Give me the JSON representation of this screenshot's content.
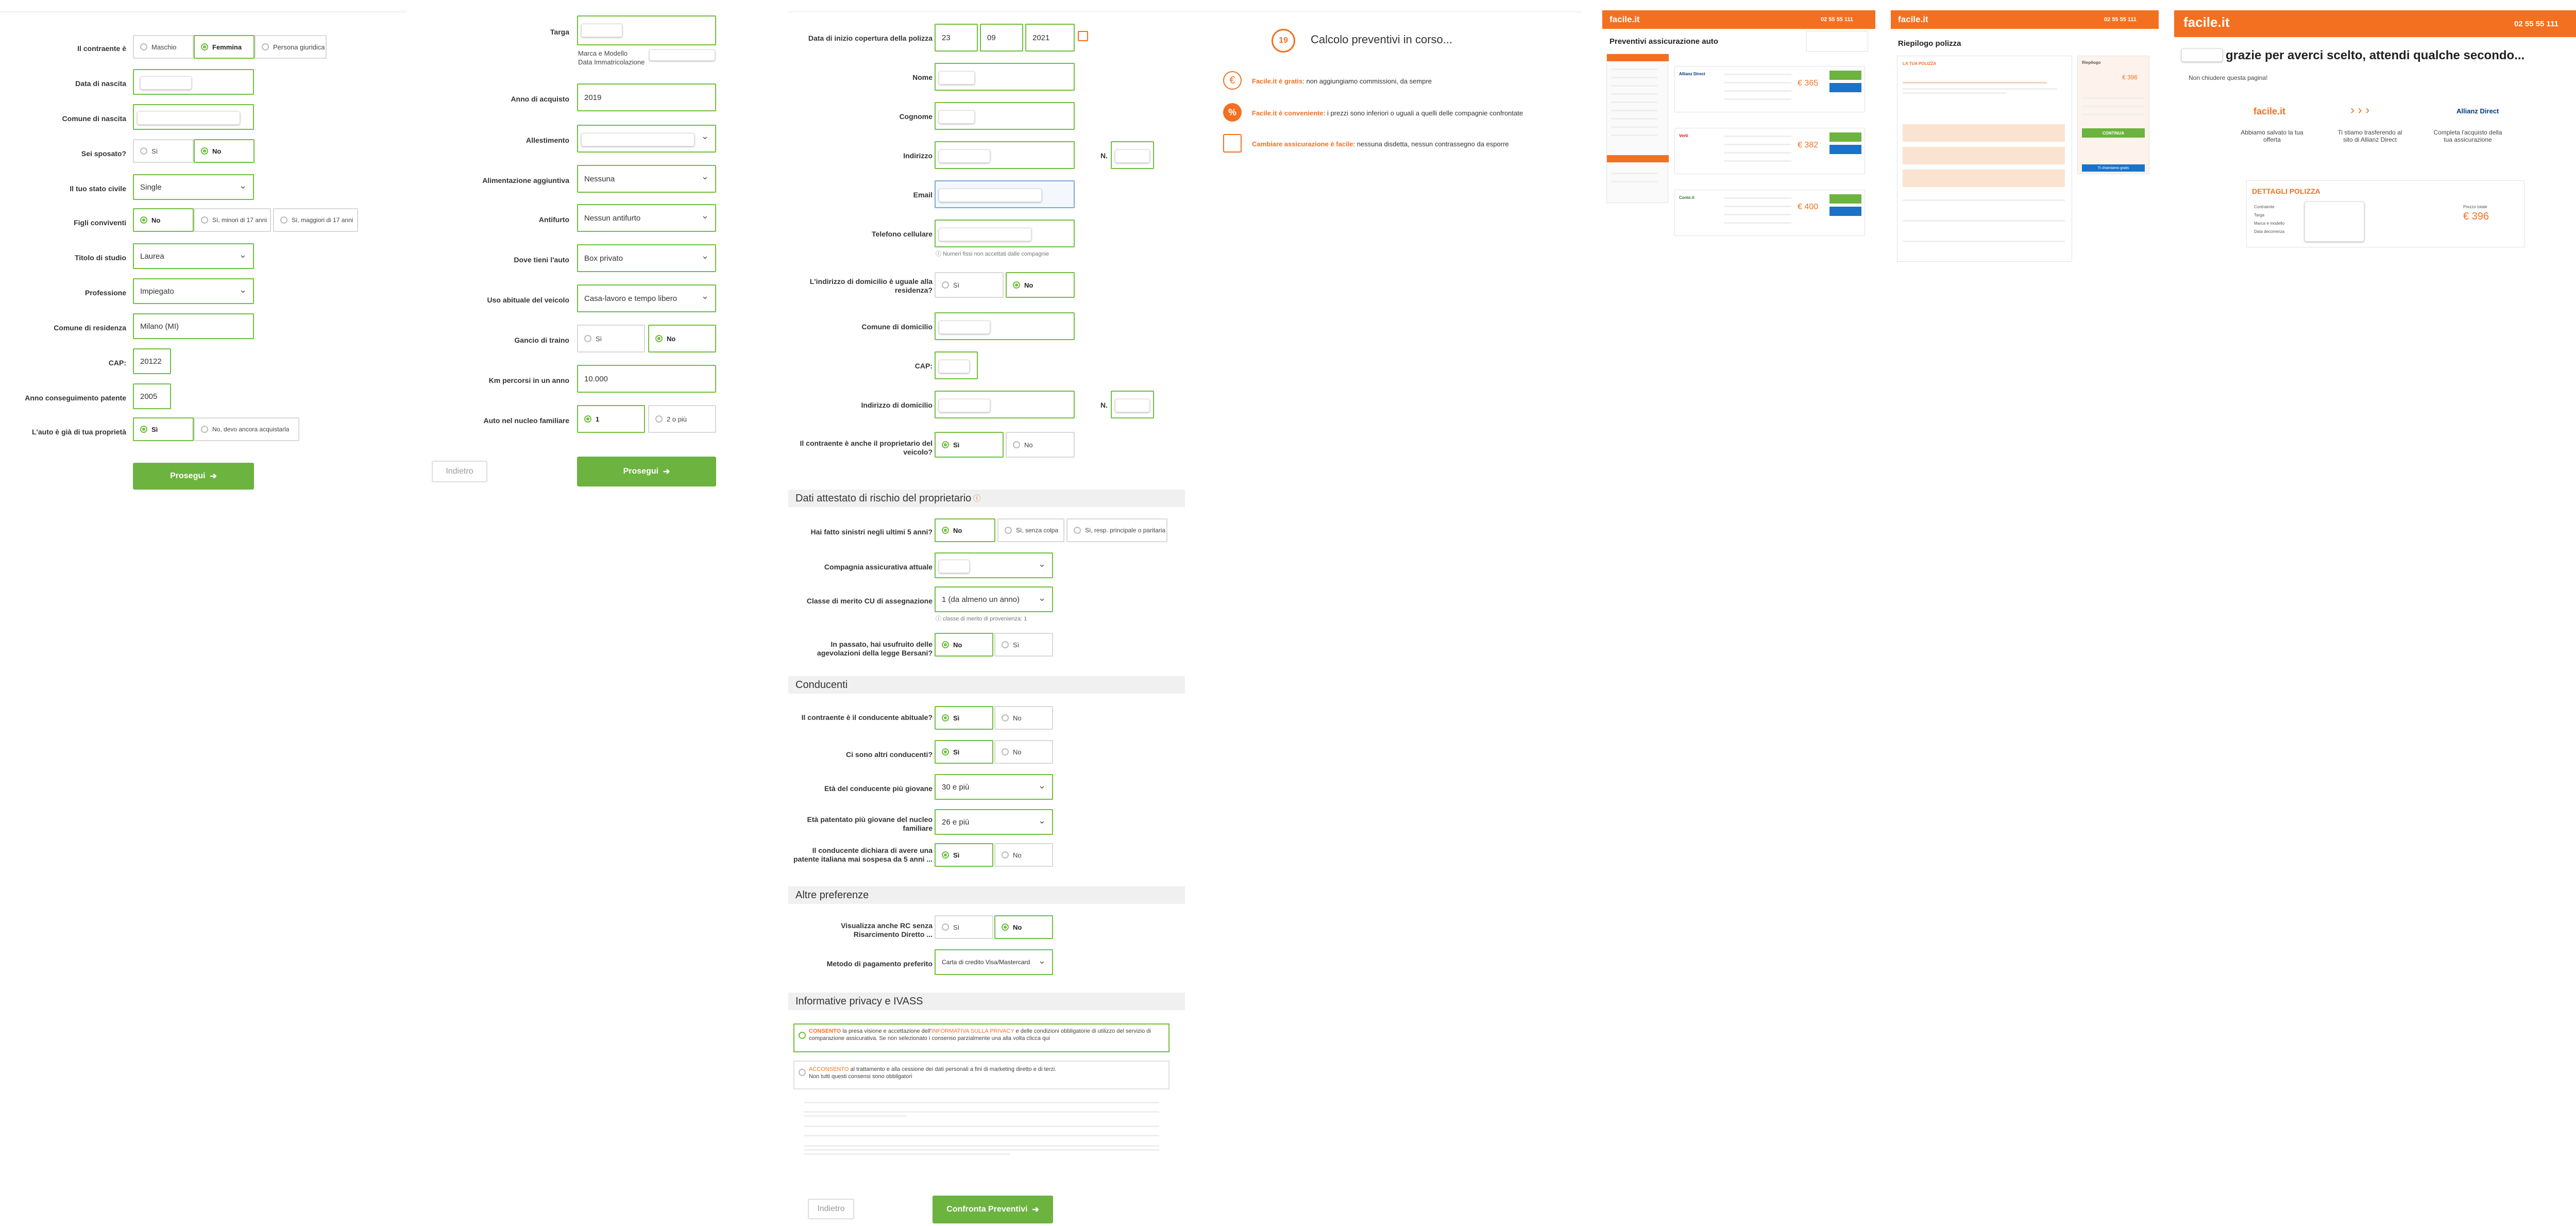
{
  "panel1": {
    "contraente_label": "Il contraente è",
    "gender_options": [
      "Maschio",
      "Femmina",
      "Persona giuridica"
    ],
    "data_nascita_label": "Data di nascita",
    "comune_nascita_label": "Comune di nascita",
    "sposato_label": "Sei sposato?",
    "yes": "Sì",
    "no": "No",
    "stato_civile_label": "Il tuo stato civile",
    "stato_civile_value": "Single",
    "figli_label": "Figli conviventi",
    "figli_options": [
      "No",
      "Sì, minori di 17 anni",
      "Sì, maggiori di 17 anni"
    ],
    "titolo_studio_label": "Titolo di studio",
    "titolo_studio_value": "Laurea",
    "professione_label": "Professione",
    "professione_value": "Impiegato",
    "comune_residenza_label": "Comune di residenza",
    "comune_residenza_value": "Milano (MI)",
    "cap_label": "CAP:",
    "cap_value": "20122",
    "anno_patente_label": "Anno conseguimento patente",
    "anno_patente_value": "2005",
    "auto_label": "L'auto è già di tua proprietà",
    "auto_options": [
      "Sì",
      "No, devo ancora acquistarla"
    ],
    "prosegui": "Prosegui"
  },
  "panel2": {
    "targa_label": "Targa",
    "targa_hint_1": "Marca e Modello",
    "targa_hint_2": "Data Immatricolazione",
    "anno_acquisto_label": "Anno di acquisto",
    "anno_acquisto_value": "2019",
    "allestimento_label": "Allestimento",
    "alimentazione_label": "Alimentazione aggiuntiva",
    "alimentazione_value": "Nessuna",
    "antifurto_label": "Antifurto",
    "antifurto_value": "Nessun antifurto",
    "dove_label": "Dove tieni l'auto",
    "dove_value": "Box privato",
    "uso_label": "Uso abituale del veicolo",
    "uso_value": "Casa-lavoro e tempo libero",
    "gancio_label": "Gancio di traino",
    "yes": "Sì",
    "no": "No",
    "km_label": "Km percorsi in un anno",
    "km_value": "10.000",
    "auto_nucleo_label": "Auto nel nucleo familiare",
    "auto_nucleo_options": [
      "1",
      "2 o più"
    ],
    "indietro": "Indietro",
    "prosegui": "Prosegui"
  },
  "panel3": {
    "data_inizio_label": "Data di inizio copertura della polizza",
    "data_inizio": [
      "23",
      "09",
      "2021"
    ],
    "nome_label": "Nome",
    "cognome_label": "Cognome",
    "indirizzo_label": "Indirizzo",
    "n_label": "N.",
    "email_label": "Email",
    "telefono_label": "Telefono cellulare",
    "telefono_hint": "Numeri fissi non accettati dalle compagnie",
    "domicilio_uguale_label": "L'indirizzo di domicilio è uguale alla residenza?",
    "yes": "Sì",
    "no": "No",
    "comune_domicilio_label": "Comune di domicilio",
    "cap_label": "CAP:",
    "indirizzo_domicilio_label": "Indirizzo di domicilio",
    "proprietario_label": "Il contraente è anche il proprietario del veicolo?",
    "sec_attestato": "Dati attestato di rischio del proprietario",
    "sinistri_label": "Hai fatto sinistri negli ultimi 5 anni?",
    "sinistri_options": [
      "No",
      "Sì, senza colpa",
      "Sì, resp. principale o paritaria"
    ],
    "compagnia_label": "Compagnia assicurativa attuale",
    "classe_label": "Classe di merito CU di assegnazione",
    "classe_value": "1 (da almeno un anno)",
    "classe_hint": "classe di merito di provenienza: 1",
    "bersani_label": "In passato, hai usufruito delle agevolazioni della legge Bersani?",
    "sec_conducenti": "Conducenti",
    "conducente_abituale_label": "Il contraente è il conducente abituale?",
    "altri_conducenti_label": "Ci sono altri conducenti?",
    "eta_giovane_label": "Età del conducente più giovane",
    "eta_giovane_value": "30 e più",
    "patentato_label": "Età patentato più giovane del nucleo familiare",
    "patentato_value": "26 e più",
    "sospesa_label": "Il conducente dichiara di avere una patente italiana mai sospesa da 5 anni ...",
    "sec_preferenze": "Altre preferenze",
    "rc_label": "Visualizza anche RC senza Risarcimento Diretto ...",
    "pagamento_label": "Metodo di pagamento preferito",
    "pagamento_value": "Carta di credito Visa/Mastercard",
    "sec_privacy": "Informative privacy e IVASS",
    "consent1_strong": "CONSENTO",
    "consent1_mid": " la presa visione e accettazione dell'",
    "consent1_link": "INFORMATIVA SULLA PRIVACY",
    "consent1_rest": " e delle condizioni obbligatorie di utilizzo del servizio di comparazione assicurativa. Se non selezionato i consenso parzialmente una alla volta clicca qui",
    "consent2_strong": "ACCONSENTO",
    "consent2_rest": " al trattamento e alla cessione dei dati personali a fini di marketing diretto e di terzi.",
    "consent2_note": "Non tutti questi consensi sono obbligatori",
    "indietro": "Indietro",
    "confronta": "Confronta Preventivi"
  },
  "panel4": {
    "step_number": "19",
    "title": "Calcolo preventivi in corso...",
    "b1_strong": "Facile.it è gratis",
    "b1_rest": ": non aggiungiamo commissioni, da sempre",
    "b2_strong": "Facile.it è conveniente",
    "b2_rest": ": i prezzi sono inferiori o uguali a quelli delle compagnie confrontate",
    "b3_strong": "Cambiare assicurazione è facile",
    "b3_rest": ": nessuna disdetta, nessun contrassegno da esporre"
  },
  "panel5": {
    "logo": "facile.it",
    "phone": "02 55 55 111",
    "title": "Preventivi assicurazione auto",
    "prices": [
      "€ 365",
      "€ 382",
      "€ 400"
    ]
  },
  "panel6": {
    "logo": "facile.it",
    "phone": "02 55 55 111",
    "title": "Riepilogo polizza",
    "subtitle": "LA TUA POLIZZA",
    "card_title": "Riepilogo",
    "card_price": "€ 396",
    "card_btn": "CONTINUA",
    "card_btn2": "Ti chiamiamo gratis"
  },
  "panel7": {
    "logo": "facile.it",
    "phone": "02 55 55 111",
    "title": "grazie per averci scelto, attendi qualche secondo...",
    "subtitle": "Non chiudere questa pagina!",
    "step1": "Abbiamo salvato la tua offerta",
    "step2": "Ti stiamo trasferendo al sito di Allianz Direct",
    "step3": "Completa l'acquisto della tua assicurazione",
    "details_title": "DETTAGLI POLIZZA",
    "price_label": "Prezzo totale",
    "price": "€ 396",
    "rows": [
      "Contraente",
      "Targa",
      "Marca e modello",
      "Data decorrenza"
    ]
  },
  "colors": {
    "green": "#6cb33f",
    "orange": "#f37021"
  }
}
